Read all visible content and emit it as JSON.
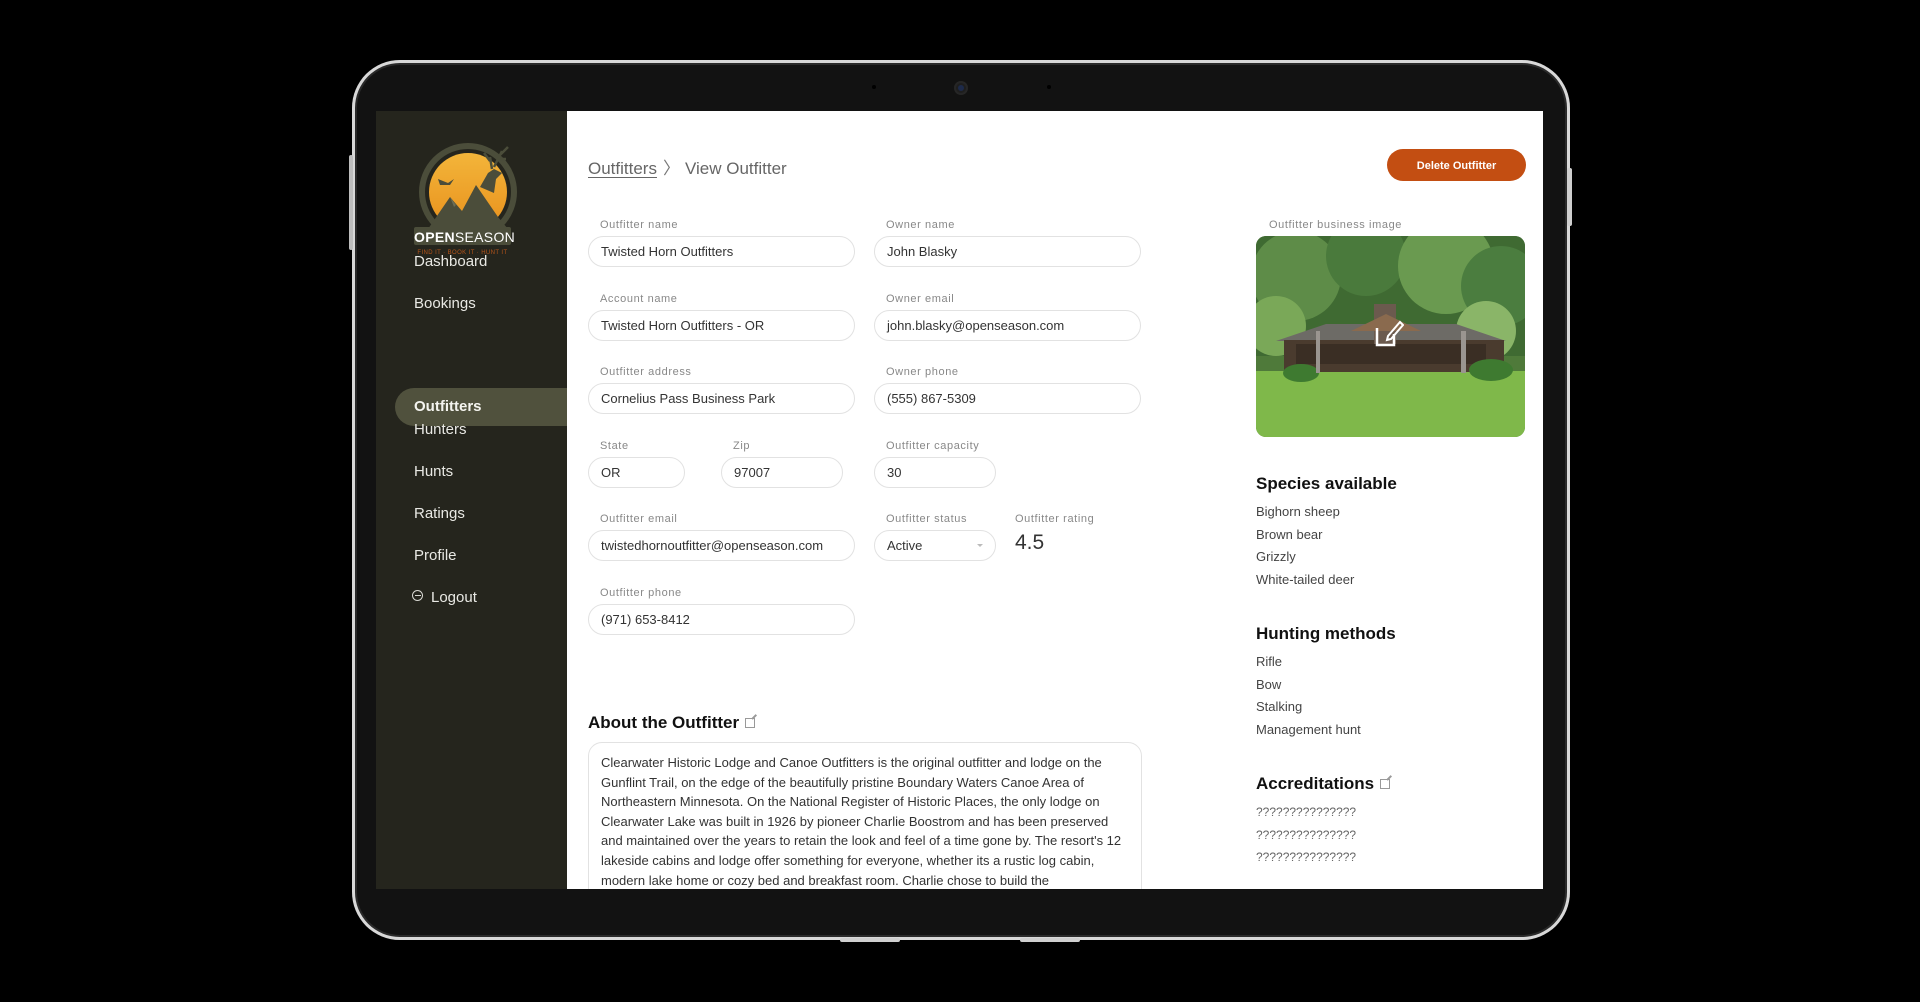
{
  "sidebar": {
    "logo": {
      "brand_open": "OPEN",
      "brand_season": "SEASON",
      "tagline": "FIND IT · BOOK IT · HUNT IT"
    },
    "items": [
      {
        "label": "Dashboard",
        "active": false
      },
      {
        "label": "Bookings",
        "active": false
      },
      {
        "label": "Outfitters",
        "active": true
      },
      {
        "label": "Hunters",
        "active": false
      },
      {
        "label": "Hunts",
        "active": false
      },
      {
        "label": "Ratings",
        "active": false
      },
      {
        "label": "Profile",
        "active": false
      }
    ],
    "logout_label": "Logout"
  },
  "header": {
    "breadcrumb_parent": "Outfitters",
    "breadcrumb_separator": "〉",
    "breadcrumb_current": "View Outfitter",
    "delete_label": "Delete Outfitter"
  },
  "form": {
    "outfitter_name": {
      "label": "Outfitter name",
      "value": "Twisted Horn Outfitters"
    },
    "owner_name": {
      "label": "Owner name",
      "value": "John Blasky"
    },
    "account_name": {
      "label": "Account name",
      "value": "Twisted Horn Outfitters - OR"
    },
    "owner_email": {
      "label": "Owner email",
      "value": "john.blasky@openseason.com"
    },
    "outfitter_address": {
      "label": "Outfitter address",
      "value": "Cornelius Pass Business Park"
    },
    "owner_phone": {
      "label": "Owner phone",
      "value": "(555) 867-5309"
    },
    "state": {
      "label": "State",
      "value": "OR"
    },
    "zip": {
      "label": "Zip",
      "value": "97007"
    },
    "outfitter_capacity": {
      "label": "Outfitter capacity",
      "value": "30"
    },
    "outfitter_email": {
      "label": "Outfitter email",
      "value": "twistedhornoutfitter@openseason.com"
    },
    "outfitter_status": {
      "label": "Outfitter status",
      "value": "Active"
    },
    "outfitter_rating": {
      "label": "Outfitter rating",
      "value": "4.5"
    },
    "outfitter_phone": {
      "label": "Outfitter phone",
      "value": "(971) 653-8412"
    }
  },
  "about": {
    "title": "About the Outfitter",
    "text": "Clearwater Historic Lodge and Canoe Outfitters is the original outfitter and lodge on the Gunflint Trail, on the edge of the beautifully pristine Boundary Waters Canoe Area of Northeastern Minnesota.  On the National Register of Historic Places, the only lodge on Clearwater Lake was built in 1926 by pioneer Charlie Boostrom and has been preserved and maintained over the years to retain the look and feel of a time gone by.  The resort's 12 lakeside cabins and lodge offer something for everyone, whether its a rustic log cabin, modern lake home or cozy bed and breakfast room.  Charlie chose to build the"
  },
  "right": {
    "image_label": "Outfitter business image",
    "species_title": "Species available",
    "species": [
      "Bighorn sheep",
      "Brown bear",
      "Grizzly",
      "White-tailed deer"
    ],
    "methods_title": "Hunting methods",
    "methods": [
      "Rifle",
      "Bow",
      "Stalking",
      "Management hunt"
    ],
    "accreditations_title": "Accreditations",
    "accreditations": [
      "???????????????",
      "???????????????",
      "???????????????"
    ]
  },
  "colors": {
    "sidebar_bg": "#25251d",
    "active_nav": "#50513d",
    "accent": "#c34e12",
    "logo_gold": "#f0a020",
    "logo_olive": "#4b4d3a"
  }
}
